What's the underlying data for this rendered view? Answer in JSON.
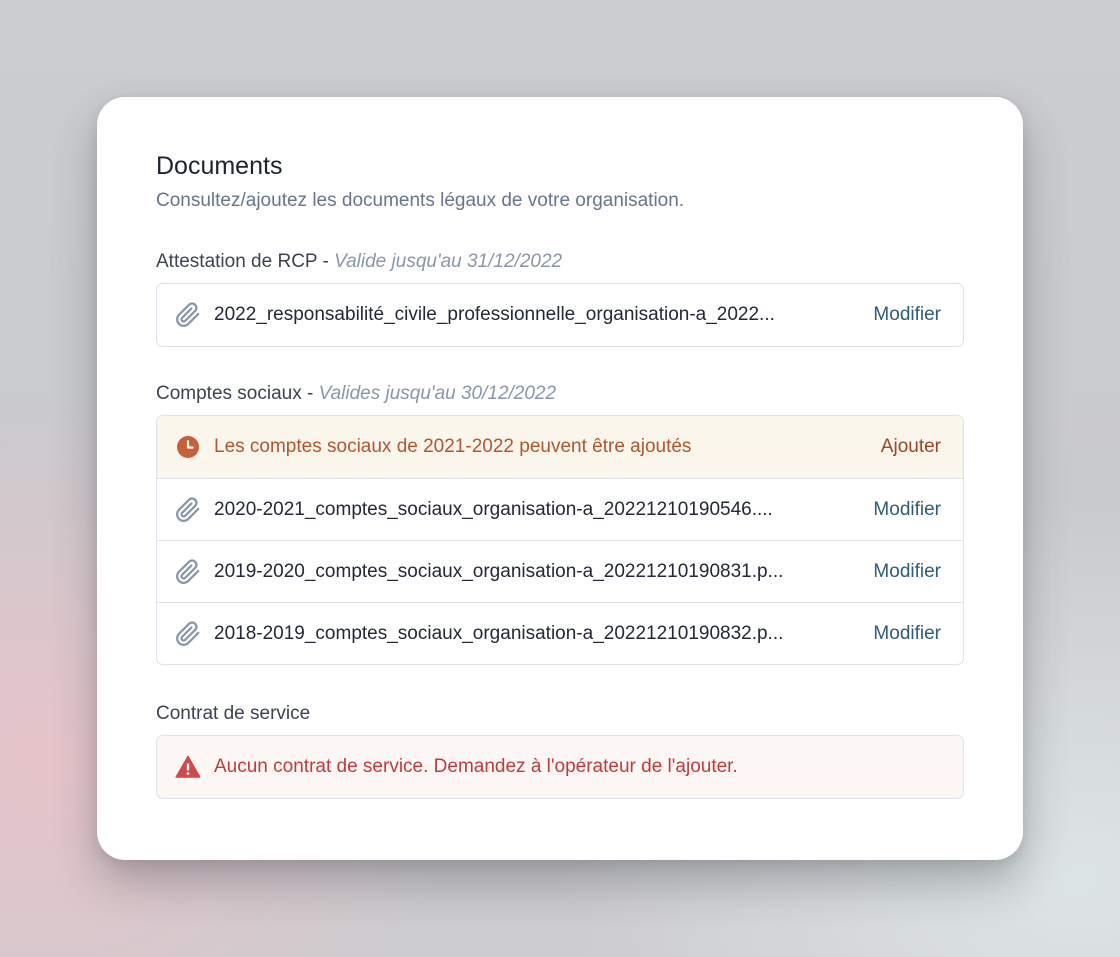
{
  "header": {
    "title": "Documents",
    "subtitle": "Consultez/ajoutez les documents légaux de votre organisation."
  },
  "sections": [
    {
      "label": "Attestation de RCP",
      "separator": " - ",
      "validity": "Valide jusqu'au 31/12/2022",
      "files": [
        {
          "name": "2022_responsabilité_civile_professionnelle_organisation-a_2022...",
          "action": "Modifier"
        }
      ]
    },
    {
      "label": "Comptes sociaux",
      "separator": " - ",
      "validity": "Valides jusqu'au 30/12/2022",
      "notice": {
        "text": "Les comptes sociaux de 2021-2022 peuvent être ajoutés",
        "action": "Ajouter"
      },
      "files": [
        {
          "name": "2020-2021_comptes_sociaux_organisation-a_20221210190546....",
          "action": "Modifier"
        },
        {
          "name": "2019-2020_comptes_sociaux_organisation-a_20221210190831.p...",
          "action": "Modifier"
        },
        {
          "name": "2018-2019_comptes_sociaux_organisation-a_20221210190832.p...",
          "action": "Modifier"
        }
      ]
    },
    {
      "label": "Contrat de service",
      "error": {
        "text": "Aucun contrat de service. Demandez à l'opérateur de l'ajouter."
      }
    }
  ],
  "icons": {
    "attachment": "paperclip-icon",
    "pending": "clock-icon",
    "error": "warning-triangle-icon"
  },
  "colors": {
    "link": "#2b5f78",
    "warning_text": "#b2562d",
    "warning_bg": "#fbf6ec",
    "error_text": "#c23b3b",
    "error_bg": "#fcf6f5",
    "muted": "#66768e"
  }
}
